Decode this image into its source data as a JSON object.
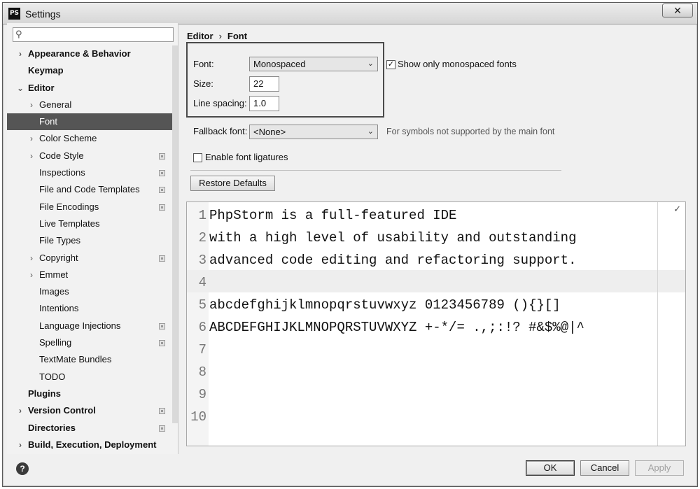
{
  "window": {
    "title": "Settings",
    "app_icon": "PS",
    "close_glyph": "✕"
  },
  "search": {
    "value": "",
    "icon": "search-icon"
  },
  "sidebar": {
    "items": [
      {
        "label": "Appearance & Behavior",
        "level": 0,
        "bold": true,
        "chevron": "›"
      },
      {
        "label": "Keymap",
        "level": 0,
        "bold": true,
        "chevron": ""
      },
      {
        "label": "Editor",
        "level": 0,
        "bold": true,
        "chevron": "⌄"
      },
      {
        "label": "General",
        "level": 1,
        "chevron": "›"
      },
      {
        "label": "Font",
        "level": 1,
        "selected": true
      },
      {
        "label": "Color Scheme",
        "level": 1,
        "chevron": "›"
      },
      {
        "label": "Code Style",
        "level": 1,
        "chevron": "›",
        "project": true
      },
      {
        "label": "Inspections",
        "level": 1,
        "project": true
      },
      {
        "label": "File and Code Templates",
        "level": 1,
        "project": true
      },
      {
        "label": "File Encodings",
        "level": 1,
        "project": true
      },
      {
        "label": "Live Templates",
        "level": 1
      },
      {
        "label": "File Types",
        "level": 1
      },
      {
        "label": "Copyright",
        "level": 1,
        "chevron": "›",
        "project": true
      },
      {
        "label": "Emmet",
        "level": 1,
        "chevron": "›"
      },
      {
        "label": "Images",
        "level": 1
      },
      {
        "label": "Intentions",
        "level": 1
      },
      {
        "label": "Language Injections",
        "level": 1,
        "project": true
      },
      {
        "label": "Spelling",
        "level": 1,
        "project": true
      },
      {
        "label": "TextMate Bundles",
        "level": 1
      },
      {
        "label": "TODO",
        "level": 1
      },
      {
        "label": "Plugins",
        "level": 0,
        "bold": true
      },
      {
        "label": "Version Control",
        "level": 0,
        "bold": true,
        "chevron": "›",
        "project": true
      },
      {
        "label": "Directories",
        "level": 0,
        "bold": true,
        "project": true
      },
      {
        "label": "Build, Execution, Deployment",
        "level": 0,
        "bold": true,
        "chevron": "›"
      }
    ]
  },
  "breadcrumb": {
    "parent": "Editor",
    "sep": "›",
    "current": "Font"
  },
  "font": {
    "font_label": "Font:",
    "font_value": "Monospaced",
    "size_label": "Size:",
    "size_value": "22",
    "spacing_label": "Line spacing:",
    "spacing_value": "1.0",
    "mono_only_label": "Show only monospaced fonts",
    "mono_only_checked": true,
    "fallback_label": "Fallback font:",
    "fallback_value": "<None>",
    "fallback_hint": "For symbols not supported by the main font",
    "ligatures_label": "Enable font ligatures",
    "ligatures_checked": false,
    "restore_label": "Restore Defaults"
  },
  "preview": {
    "lines": [
      {
        "n": "1",
        "text": "PhpStorm is a full-featured IDE"
      },
      {
        "n": "2",
        "text": "with a high level of usability and outstanding"
      },
      {
        "n": "3",
        "text": "advanced code editing and refactoring support."
      },
      {
        "n": "4",
        "text": ""
      },
      {
        "n": "5",
        "text": "abcdefghijklmnopqrstuvwxyz 0123456789 (){}[]"
      },
      {
        "n": "6",
        "text": "ABCDEFGHIJKLMNOPQRSTUVWXYZ +-*/= .,;:!? #&$%@|^"
      },
      {
        "n": "7",
        "text": ""
      },
      {
        "n": "8",
        "text": ""
      },
      {
        "n": "9",
        "text": ""
      },
      {
        "n": "10",
        "text": ""
      }
    ]
  },
  "footer": {
    "ok": "OK",
    "cancel": "Cancel",
    "apply": "Apply",
    "help": "?"
  }
}
